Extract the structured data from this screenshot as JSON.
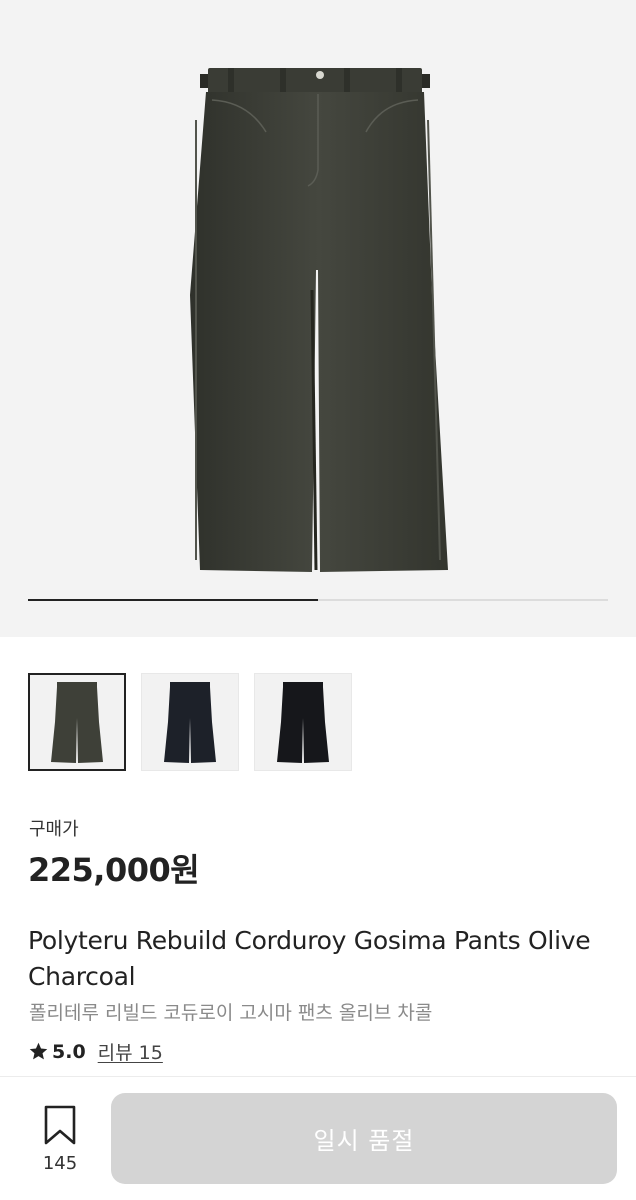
{
  "gallery": {
    "current_index": 1,
    "total": 2
  },
  "thumbnails": [
    {
      "color": "#3e4038",
      "selected": true
    },
    {
      "color": "#1d2129",
      "selected": false
    },
    {
      "color": "#16171b",
      "selected": false
    }
  ],
  "price": {
    "label": "구매가",
    "value": "225,000원"
  },
  "product": {
    "name_en": "Polyteru Rebuild Corduroy Gosima Pants Olive Charcoal",
    "name_ko": "폴리테루 리빌드 코듀로이 고시마 팬츠 올리브 차콜",
    "color": "#3e4038"
  },
  "rating": {
    "icon": "star-icon",
    "value": "5.0",
    "review_label": "리뷰 15"
  },
  "bottom_bar": {
    "bookmark_icon": "bookmark-icon",
    "bookmark_count": "145",
    "button_label": "일시 품절"
  },
  "colors": {
    "background": "#ffffff",
    "hero_background": "#f3f3f3",
    "text_primary": "#222222",
    "text_secondary": "#8a8a8a",
    "disabled_button": "#d4d4d4"
  }
}
